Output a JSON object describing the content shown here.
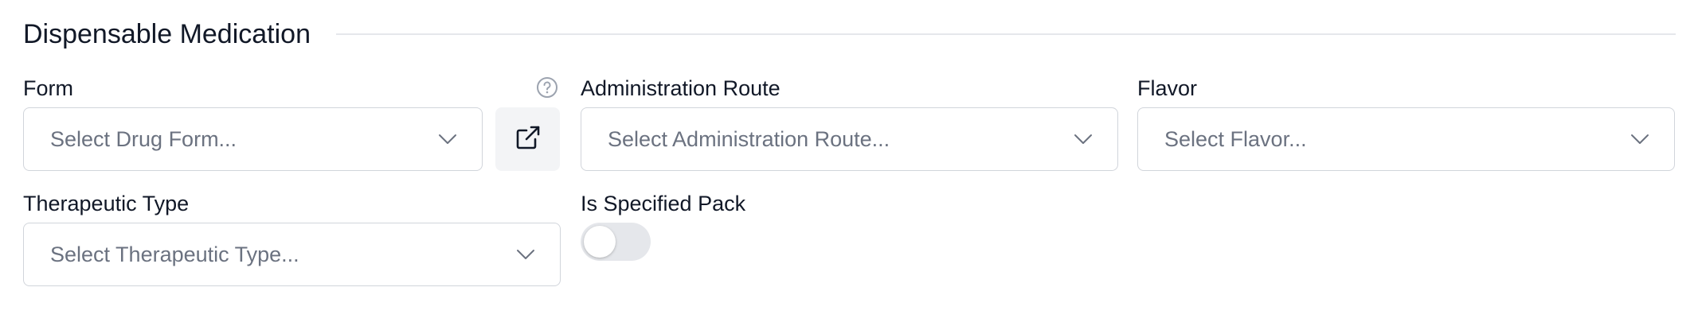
{
  "section": {
    "title": "Dispensable Medication"
  },
  "fields": {
    "form": {
      "label": "Form",
      "placeholder": "Select Drug Form...",
      "help_icon": "question-circle-icon",
      "action_icon": "external-link-icon"
    },
    "administration_route": {
      "label": "Administration Route",
      "placeholder": "Select Administration Route..."
    },
    "flavor": {
      "label": "Flavor",
      "placeholder": "Select Flavor..."
    },
    "therapeutic_type": {
      "label": "Therapeutic Type",
      "placeholder": "Select Therapeutic Type..."
    },
    "is_specified_pack": {
      "label": "Is Specified Pack",
      "checked": false
    }
  },
  "colors": {
    "text": "#111827",
    "placeholder": "#6b7280",
    "border": "#d1d5db",
    "toggle_off": "#e5e7eb",
    "icon_button_bg": "#f3f4f6"
  }
}
